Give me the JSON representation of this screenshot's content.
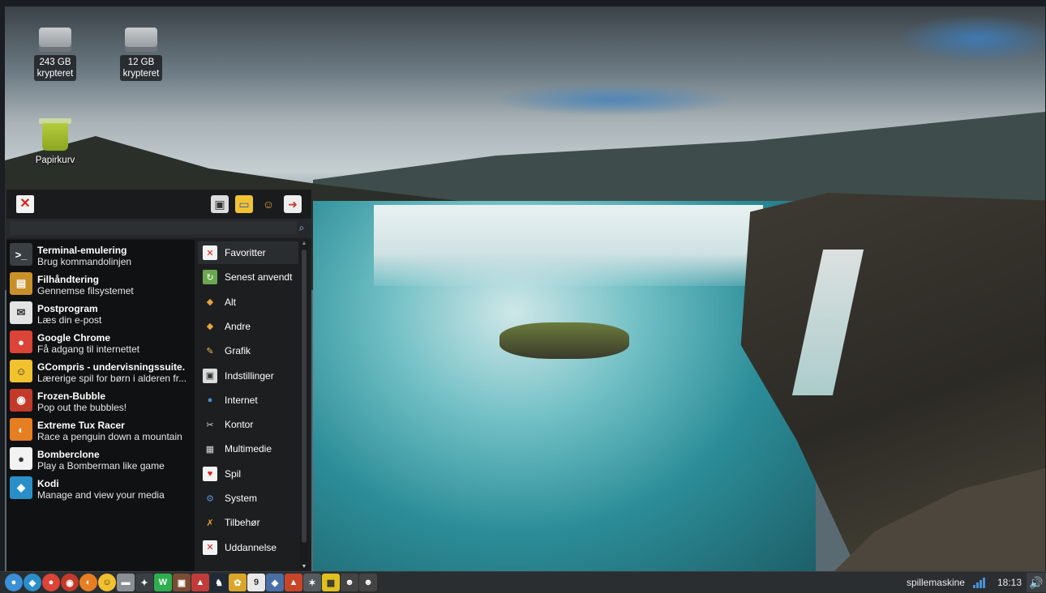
{
  "desktop": {
    "icons": [
      {
        "label_line1": "243 GB",
        "label_line2": "krypteret",
        "icon": "drive-icon"
      },
      {
        "label_line1": "12 GB",
        "label_line2": "krypteret",
        "icon": "drive-icon"
      },
      {
        "label_line1": "Papirkurv",
        "icon": "trash-icon"
      }
    ]
  },
  "menu": {
    "close_symbol": "✕",
    "top_icons": [
      "settings-icon",
      "display-icon",
      "users-icon",
      "logout-icon"
    ],
    "search": {
      "value": "",
      "placeholder": ""
    },
    "apps": [
      {
        "title": "Terminal-emulering",
        "subtitle": "Brug kommandolinjen",
        "icon": "terminal-icon",
        "glyph": ">_",
        "color": "#3a3f44"
      },
      {
        "title": "Filhåndtering",
        "subtitle": "Gennemse filsystemet",
        "icon": "file-manager-icon",
        "glyph": "▤",
        "color": "#c9902a"
      },
      {
        "title": "Postprogram",
        "subtitle": "Læs din e-post",
        "icon": "mail-icon",
        "glyph": "✉",
        "color": "#e3e3e3"
      },
      {
        "title": "Google Chrome",
        "subtitle": "Få adgang til internettet",
        "icon": "chrome-icon",
        "glyph": "●",
        "color": "#db4437"
      },
      {
        "title": "GCompris - undervisningssuite.",
        "subtitle": "Lærerige spil for børn i alderen fr...",
        "icon": "gcompris-icon",
        "glyph": "☺",
        "color": "#f2c12e"
      },
      {
        "title": "Frozen-Bubble",
        "subtitle": "Pop out the bubbles!",
        "icon": "frozen-bubble-icon",
        "glyph": "◉",
        "color": "#c33a2a"
      },
      {
        "title": "Extreme Tux Racer",
        "subtitle": "Race a penguin down a mountain",
        "icon": "tux-racer-icon",
        "glyph": "◐",
        "color": "#e67e22"
      },
      {
        "title": "Bomberclone",
        "subtitle": "Play a Bomberman like game",
        "icon": "bomberclone-icon",
        "glyph": "●",
        "color": "#f2f2f2"
      },
      {
        "title": "Kodi",
        "subtitle": "Manage and view your media",
        "icon": "kodi-icon",
        "glyph": "◆",
        "color": "#2a8fc9"
      }
    ],
    "categories": [
      {
        "label": "Favoritter",
        "icon": "favorites-icon",
        "glyph": "✕",
        "color": "#f3f3f3",
        "fg": "#d9241b"
      },
      {
        "label": "Senest anvendt",
        "icon": "recent-icon",
        "glyph": "↻",
        "color": "#6aa84f",
        "fg": "#fff"
      },
      {
        "label": "Alt",
        "icon": "all-icon",
        "glyph": "◆",
        "color": "transparent",
        "fg": "#e8a33c"
      },
      {
        "label": "Andre",
        "icon": "other-icon",
        "glyph": "◆",
        "color": "transparent",
        "fg": "#e8a33c"
      },
      {
        "label": "Grafik",
        "icon": "graphics-icon",
        "glyph": "✎",
        "color": "transparent",
        "fg": "#e6c35c"
      },
      {
        "label": "Indstillinger",
        "icon": "settings-icon",
        "glyph": "▣",
        "color": "#dcdcdc",
        "fg": "#333"
      },
      {
        "label": "Internet",
        "icon": "internet-icon",
        "glyph": "●",
        "color": "transparent",
        "fg": "#4a90d9"
      },
      {
        "label": "Kontor",
        "icon": "office-icon",
        "glyph": "✂",
        "color": "transparent",
        "fg": "#cfcfcf"
      },
      {
        "label": "Multimedie",
        "icon": "multimedia-icon",
        "glyph": "▦",
        "color": "transparent",
        "fg": "#dcdcdc"
      },
      {
        "label": "Spil",
        "icon": "games-icon",
        "glyph": "♥",
        "color": "#f3f3f3",
        "fg": "#d9241b"
      },
      {
        "label": "System",
        "icon": "system-icon",
        "glyph": "⚙",
        "color": "transparent",
        "fg": "#5b8fd6"
      },
      {
        "label": "Tilbehør",
        "icon": "accessories-icon",
        "glyph": "✗",
        "color": "transparent",
        "fg": "#e3a23a"
      },
      {
        "label": "Uddannelse",
        "icon": "education-icon",
        "glyph": "✕",
        "color": "#f3f3f3",
        "fg": "#d9241b"
      }
    ]
  },
  "taskbar": {
    "launchers": [
      {
        "name": "menu-launcher-icon",
        "glyph": "●",
        "color": "#3b8fd6"
      },
      {
        "name": "kodi-launcher-icon",
        "glyph": "◆",
        "color": "#2a8fc9"
      },
      {
        "name": "chrome-launcher-icon",
        "glyph": "●",
        "color": "#db4437"
      },
      {
        "name": "frozen-bubble-launcher-icon",
        "glyph": "◉",
        "color": "#c33a2a"
      },
      {
        "name": "tux-racer-launcher-icon",
        "glyph": "◐",
        "color": "#e67e22"
      },
      {
        "name": "gcompris-launcher-icon",
        "glyph": "☺",
        "color": "#f2c12e"
      },
      {
        "name": "game-launcher-icon-1",
        "glyph": "▬",
        "color": "#8a8f94"
      },
      {
        "name": "game-launcher-icon-2",
        "glyph": "✦",
        "color": "#3a3f44"
      },
      {
        "name": "game-launcher-icon-3",
        "glyph": "W",
        "color": "#2fae4f"
      },
      {
        "name": "game-launcher-icon-4",
        "glyph": "▣",
        "color": "#7a4c33"
      },
      {
        "name": "game-launcher-icon-5",
        "glyph": "▲",
        "color": "#c23b3b"
      },
      {
        "name": "game-launcher-icon-6",
        "glyph": "♞",
        "color": "#1f2a36"
      },
      {
        "name": "game-launcher-icon-7",
        "glyph": "✿",
        "color": "#d9a62a"
      },
      {
        "name": "game-launcher-icon-8",
        "glyph": "9",
        "color": "#e9e9e9"
      },
      {
        "name": "game-launcher-icon-9",
        "glyph": "◆",
        "color": "#4a6fa5"
      },
      {
        "name": "game-launcher-icon-10",
        "glyph": "▲",
        "color": "#c9452a"
      },
      {
        "name": "game-launcher-icon-11",
        "glyph": "✶",
        "color": "#555a5f"
      },
      {
        "name": "game-launcher-icon-12",
        "glyph": "▦",
        "color": "#e0c01f"
      },
      {
        "name": "tux-launcher-icon-1",
        "glyph": "☻",
        "color": "#444"
      },
      {
        "name": "tux-launcher-icon-2",
        "glyph": "☻",
        "color": "#444"
      }
    ],
    "hostname": "spillemaskine",
    "clock": "18:13",
    "volume_symbol": "🔊"
  }
}
